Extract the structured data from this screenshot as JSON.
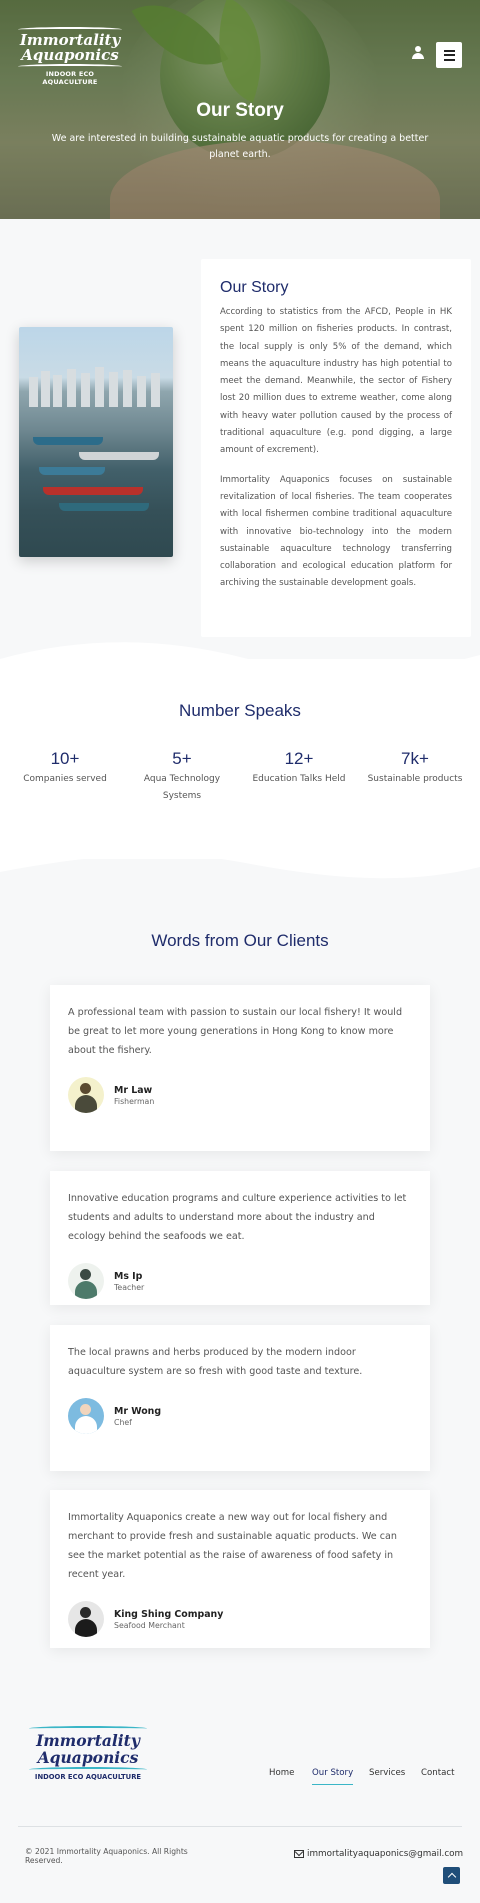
{
  "header": {
    "logo_line1": "Immortality",
    "logo_line2": "Aquaponics",
    "logo_sub": "INDOOR ECO AQUACULTURE",
    "user_icon": "user-icon",
    "menu_icon": "hamburger-menu-icon"
  },
  "hero": {
    "title": "Our Story",
    "subtitle": "We are interested in building sustainable aquatic products for creating a better planet earth."
  },
  "story": {
    "heading": "Our Story",
    "paragraph1": "According to statistics from the AFCD, People in HK spent 120 million on fisheries products. In contrast, the local supply is only 5% of the demand, which means the aquaculture industry has high potential to meet the demand. Meanwhile, the sector of Fishery lost 20 million dues to extreme weather, come along with heavy water pollution caused by the process of traditional aquaculture (e.g. pond digging, a large amount of excrement).",
    "paragraph2": "Immortality Aquaponics focuses on sustainable revitalization of local fisheries. The team cooperates with local fishermen combine traditional aquaculture with innovative bio-technology into the modern sustainable aquaculture technology transferring collaboration and ecological education platform for archiving the sustainable development goals."
  },
  "numbers": {
    "heading": "Number Speaks",
    "stats": [
      {
        "value": "10+",
        "label": "Companies served"
      },
      {
        "value": "5+",
        "label": "Aqua Technology Systems"
      },
      {
        "value": "12+",
        "label": "Education Talks Held"
      },
      {
        "value": "7k+",
        "label": "Sustainable products"
      }
    ]
  },
  "clients": {
    "heading": "Words from Our Clients",
    "testimonials": [
      {
        "quote": "A professional team with passion to sustain our local fishery! It would be great to let more young generations in Hong Kong to know more about the fishery.",
        "name": "Mr Law",
        "role": "Fisherman"
      },
      {
        "quote": "Innovative education programs and culture experience activities to let students and adults to understand more about the industry and ecology behind the seafoods we eat.",
        "name": "Ms Ip",
        "role": "Teacher"
      },
      {
        "quote": "The local prawns and herbs produced by the modern indoor aquaculture system are so fresh with good taste and texture.",
        "name": "Mr Wong",
        "role": "Chef"
      },
      {
        "quote": "Immortality Aquaponics create a new way out for local fishery and merchant to provide fresh and sustainable aquatic products. We can see the market potential as the raise of awareness of food safety in recent year.",
        "name": "King Shing Company",
        "role": "Seafood Merchant"
      }
    ]
  },
  "footer": {
    "logo_line1": "Immortality",
    "logo_line2": "Aquaponics",
    "logo_sub": "INDOOR ECO AQUACULTURE",
    "nav": [
      "Home",
      "Our Story",
      "Services",
      "Contact"
    ],
    "active_nav": "Our Story",
    "copyright": "© 2021 Immortality Aquaponics. All Rights Reserved.",
    "email": "immortalityaquaponics@gmail.com",
    "mail_icon": "mail-icon",
    "back_to_top_icon": "chevron-up-icon"
  },
  "colors": {
    "navy": "#1f2c6b",
    "teal": "#3bb6c7",
    "background": "#f7f8f9"
  }
}
